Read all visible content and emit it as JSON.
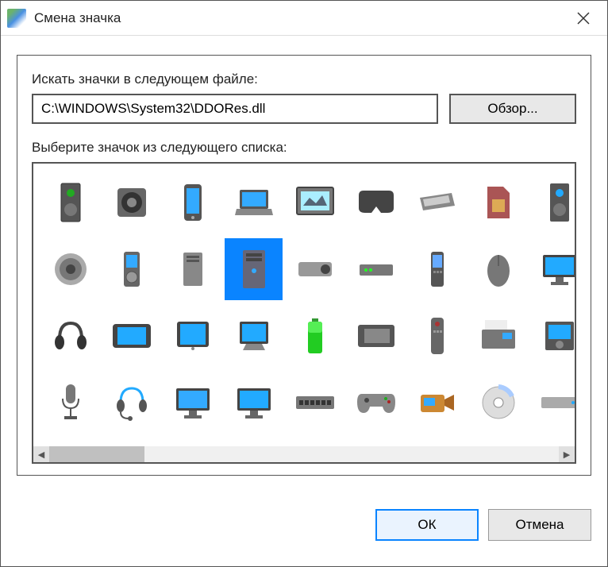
{
  "window": {
    "title": "Смена значка"
  },
  "labels": {
    "search_in_file": "Искать значки в следующем файле:",
    "select_from_list": "Выберите значок из следующего списка:"
  },
  "path": {
    "value": "C:\\WINDOWS\\System32\\DDORes.dll"
  },
  "buttons": {
    "browse": "Обзор...",
    "ok": "ОК",
    "cancel": "Отмена"
  },
  "icons": [
    {
      "name": "tower-speaker",
      "selected": false
    },
    {
      "name": "speaker",
      "selected": false
    },
    {
      "name": "smartphone",
      "selected": false
    },
    {
      "name": "laptop",
      "selected": false
    },
    {
      "name": "picture-frame",
      "selected": false
    },
    {
      "name": "vr-headset",
      "selected": false
    },
    {
      "name": "flatbed-scanner",
      "selected": false
    },
    {
      "name": "sim-card",
      "selected": false
    },
    {
      "name": "tower-speaker-2",
      "selected": false
    },
    {
      "name": "speaker-cone",
      "selected": false
    },
    {
      "name": "mp3-player",
      "selected": false
    },
    {
      "name": "desktop-tower-small",
      "selected": false
    },
    {
      "name": "desktop-tower",
      "selected": true
    },
    {
      "name": "projector",
      "selected": false
    },
    {
      "name": "modem",
      "selected": false
    },
    {
      "name": "cellphone",
      "selected": false
    },
    {
      "name": "mouse",
      "selected": false
    },
    {
      "name": "monitor-1",
      "selected": false
    },
    {
      "name": "headphones",
      "selected": false
    },
    {
      "name": "tablet-landscape",
      "selected": false
    },
    {
      "name": "tablet",
      "selected": false
    },
    {
      "name": "tablet-stand",
      "selected": false
    },
    {
      "name": "battery",
      "selected": false
    },
    {
      "name": "graphics-tablet",
      "selected": false
    },
    {
      "name": "remote-control",
      "selected": false
    },
    {
      "name": "fax-machine",
      "selected": false
    },
    {
      "name": "media-player",
      "selected": false
    },
    {
      "name": "microphone",
      "selected": false
    },
    {
      "name": "headset",
      "selected": false
    },
    {
      "name": "monitor-2",
      "selected": false
    },
    {
      "name": "monitor-3",
      "selected": false
    },
    {
      "name": "network-switch",
      "selected": false
    },
    {
      "name": "game-controller",
      "selected": false
    },
    {
      "name": "camcorder",
      "selected": false
    },
    {
      "name": "optical-disc",
      "selected": false
    },
    {
      "name": "external-drive",
      "selected": false
    }
  ]
}
